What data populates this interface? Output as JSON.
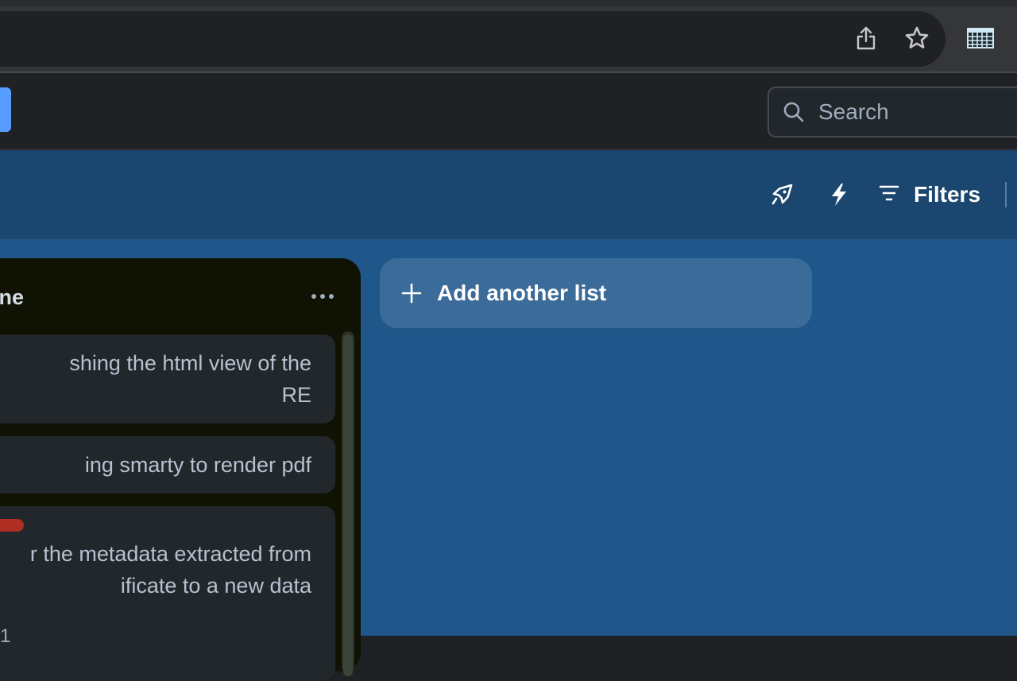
{
  "browser": {
    "share_icon": "share-icon",
    "star_icon": "star-icon",
    "extension_icon": "spreadsheet-extension-icon"
  },
  "header": {
    "search": {
      "placeholder": "Search",
      "value": ""
    }
  },
  "board_header": {
    "powerups_icon": "rocket-icon",
    "automation_icon": "lightning-icon",
    "filters_label": "Filters"
  },
  "list": {
    "title": "ne",
    "cards": [
      {
        "text": "shing the html view of the\nRE"
      },
      {
        "text": "ing smarty to render pdf"
      },
      {
        "text": "r the metadata extracted from\nificate to a new data",
        "meta": "1",
        "label_color": "#ae2e24"
      }
    ]
  },
  "add_list": {
    "label": "Add another list"
  },
  "colors": {
    "board_background": "#20578a",
    "board_header": "#1b4670",
    "list_background": "#101204",
    "card_background": "#22272b",
    "accent_blue": "#579dff"
  }
}
